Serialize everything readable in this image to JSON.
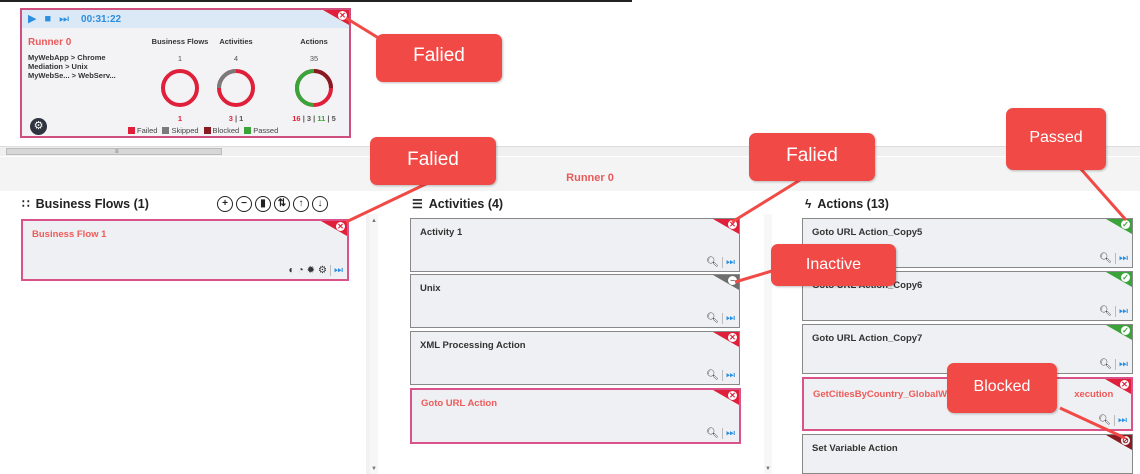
{
  "runner_card": {
    "timer": "00:31:22",
    "runner_name": "Runner 0",
    "flows": [
      "MyWebApp > Chrome",
      "Mediation > Unix",
      "MyWebSe... > WebServ..."
    ],
    "columns": [
      {
        "title": "Business Flows",
        "count": "1",
        "label_parts": [
          {
            "text": "1",
            "color": "#e0203a"
          }
        ]
      },
      {
        "title": "Activities",
        "count": "4",
        "label_parts": [
          {
            "text": "3",
            "color": "#e0203a"
          },
          {
            "text": " | ",
            "color": "#555"
          },
          {
            "text": "1",
            "color": "#555"
          }
        ]
      },
      {
        "title": "Actions",
        "count": "35",
        "label_parts": [
          {
            "text": "16",
            "color": "#e0203a"
          },
          {
            "text": " | ",
            "color": "#555"
          },
          {
            "text": "3",
            "color": "#555"
          },
          {
            "text": " | ",
            "color": "#555"
          },
          {
            "text": "11",
            "color": "#3aa33a"
          },
          {
            "text": " | ",
            "color": "#555"
          },
          {
            "text": "5",
            "color": "#555"
          }
        ]
      }
    ],
    "legend": [
      {
        "label": "Failed",
        "color": "#e0203a"
      },
      {
        "label": "Skipped",
        "color": "#7a7a7a"
      },
      {
        "label": "Blocked",
        "color": "#8a1a22"
      },
      {
        "label": "Passed",
        "color": "#3aa33a"
      }
    ]
  },
  "main_title": "Runner 0",
  "business_flows": {
    "header": "Business Flows (1)",
    "toolbar_icons": [
      "add-icon",
      "remove-icon",
      "delete-icon",
      "reorder-icon",
      "move-up-icon",
      "move-down-icon"
    ],
    "items": [
      {
        "name": "Business Flow 1",
        "status": "failed"
      }
    ]
  },
  "activities": {
    "header": "Activities (4)",
    "items": [
      {
        "name": "Activity 1",
        "status": "failed"
      },
      {
        "name": "Unix",
        "status": "inactive"
      },
      {
        "name": "XML Processing Action",
        "status": "failed"
      },
      {
        "name": "Goto URL Action",
        "status": "failed"
      }
    ]
  },
  "actions": {
    "header": "Actions (13)",
    "items": [
      {
        "name": "Goto URL Action_Copy5",
        "status": "passed"
      },
      {
        "name": "Goto URL Action_Copy6",
        "status": "passed"
      },
      {
        "name": "Goto URL Action_Copy7",
        "status": "passed"
      },
      {
        "name": "GetCitiesByCountry_GlobalWe",
        "name_suffix": "xecution",
        "status": "failed"
      },
      {
        "name": "Set Variable Action",
        "status": "blocked"
      }
    ]
  },
  "callouts": {
    "failed_1": "Falied",
    "failed_2": "Falied",
    "failed_3": "Falied",
    "passed": "Passed",
    "inactive": "Inactive",
    "blocked": "Blocked"
  },
  "colors": {
    "failed": "#e0203a",
    "passed": "#3aa33a",
    "inactive": "#6e6e6e",
    "blocked": "#8a1a22",
    "accent": "#2a8ee0",
    "callout": "#f14a46"
  }
}
